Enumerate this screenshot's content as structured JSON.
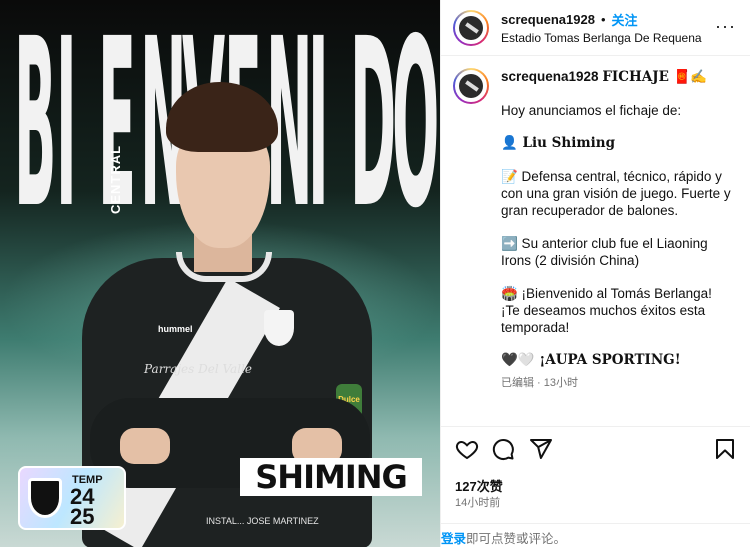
{
  "media": {
    "headline": "BIENVENIDO",
    "headline_letters": [
      "B",
      "I",
      "E",
      "N",
      "V",
      "E",
      "N",
      "I",
      "D",
      "O"
    ],
    "position": "CENTRAL",
    "player_name": "SHIMING",
    "jersey_brand": "hummel",
    "sponsor": "Parrajes Del Valle",
    "sponsor_bottom": "INSTAL... JOSE MARTINEZ",
    "season_card": {
      "label": "TEMP",
      "year1": "24",
      "year2": "25"
    },
    "badge_text": "Dulce"
  },
  "header": {
    "username": "screquena1928",
    "dot": "•",
    "follow_label": "关注",
    "location": "Estadio Tomas Berlanga De Requena",
    "more_label": "···"
  },
  "caption": {
    "username": "screquena1928",
    "title": "FICHAJE 🧧✍️",
    "line_intro": "Hoy anunciamos el fichaje de:",
    "line_name": "👤 Liu Shiming",
    "line_desc": "📝 Defensa central, técnico, rápido y con una gran visión de juego. Fuerte y gran recuperador de balones.",
    "line_club": "➡️ Su anterior club fue el Liaoning Irons (2 división China)",
    "line_welcome": "🏟️ ¡Bienvenido al Tomás Berlanga! ¡Te deseamos muchos éxitos esta temporada!",
    "line_aupa": "🖤🤍 ¡AUPA SPORTING!",
    "meta": "已编辑 · 13小时"
  },
  "stats": {
    "likes": "127次赞",
    "time": "14小时前"
  },
  "login": {
    "link": "登录",
    "text": "即可点赞或评论。"
  },
  "colors": {
    "link_blue": "#0095f6",
    "muted": "#737373",
    "border": "#efefef"
  },
  "icons": [
    "heart-icon",
    "comment-icon",
    "share-icon",
    "bookmark-icon",
    "more-icon"
  ]
}
